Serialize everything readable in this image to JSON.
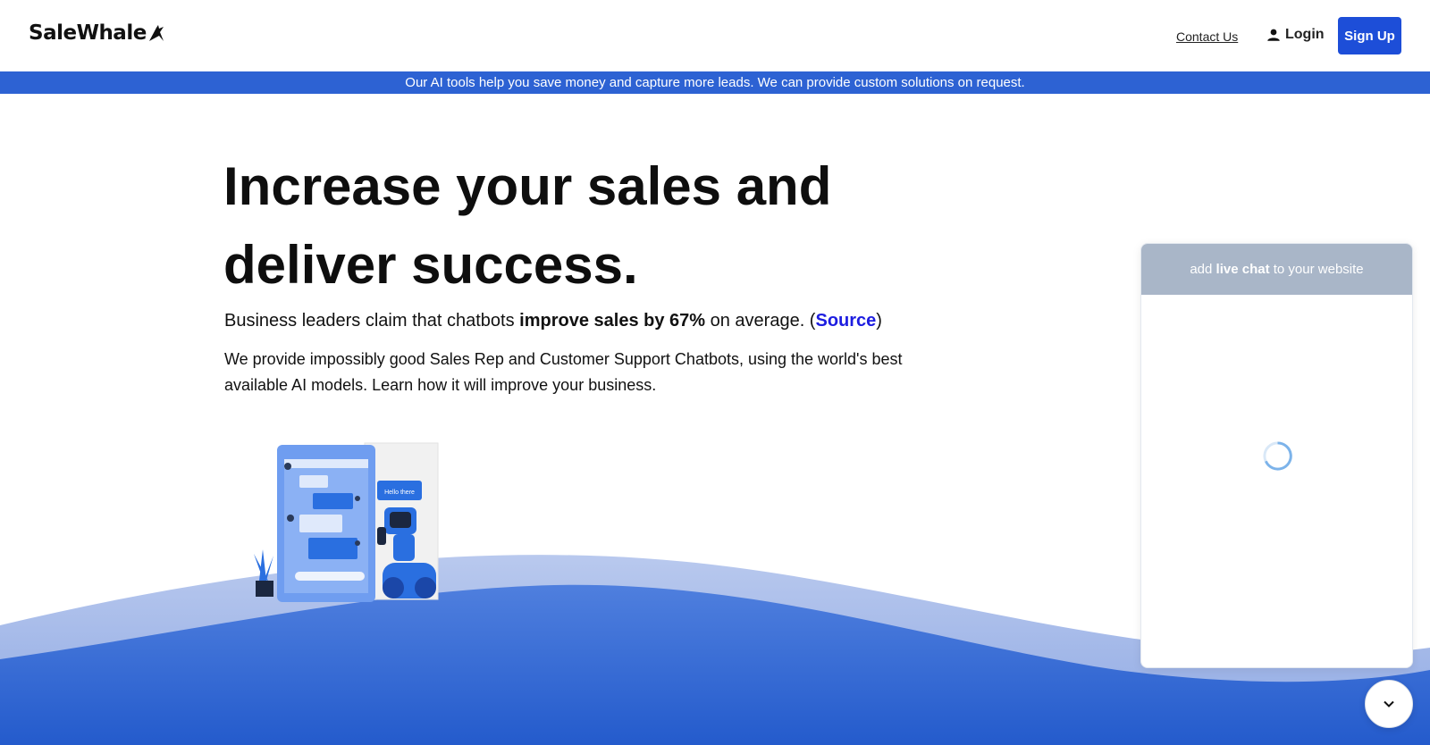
{
  "header": {
    "brand": "SaleWhale",
    "contact_label": "Contact Us",
    "login_label": "Login",
    "signup_label": "Sign Up"
  },
  "banner": {
    "text": "Our AI tools help you save money and capture more leads. We can provide custom solutions on request."
  },
  "hero": {
    "title_line1": "Increase your sales and",
    "title_line2": "deliver success.",
    "claim_prefix": "Business leaders claim that chatbots ",
    "claim_bold": "improve sales by 67%",
    "claim_suffix": " on average.  (",
    "source_label": "Source",
    "claim_close": ")",
    "description": "We provide impossibly good Sales Rep and Customer Support Chatbots, using the world's best available AI models. Learn how it will improve your business."
  },
  "illustration": {
    "bubble_text": "Hello there"
  },
  "chat_widget": {
    "header_prefix": "add ",
    "header_bold": "live chat",
    "header_suffix": " to your website"
  },
  "colors": {
    "brand_blue": "#1d4ed8",
    "banner_blue": "#2d62d3",
    "link_blue": "#1d1de0",
    "wave_light": "#a8bce8",
    "wave_dark": "#2b5fcf"
  }
}
